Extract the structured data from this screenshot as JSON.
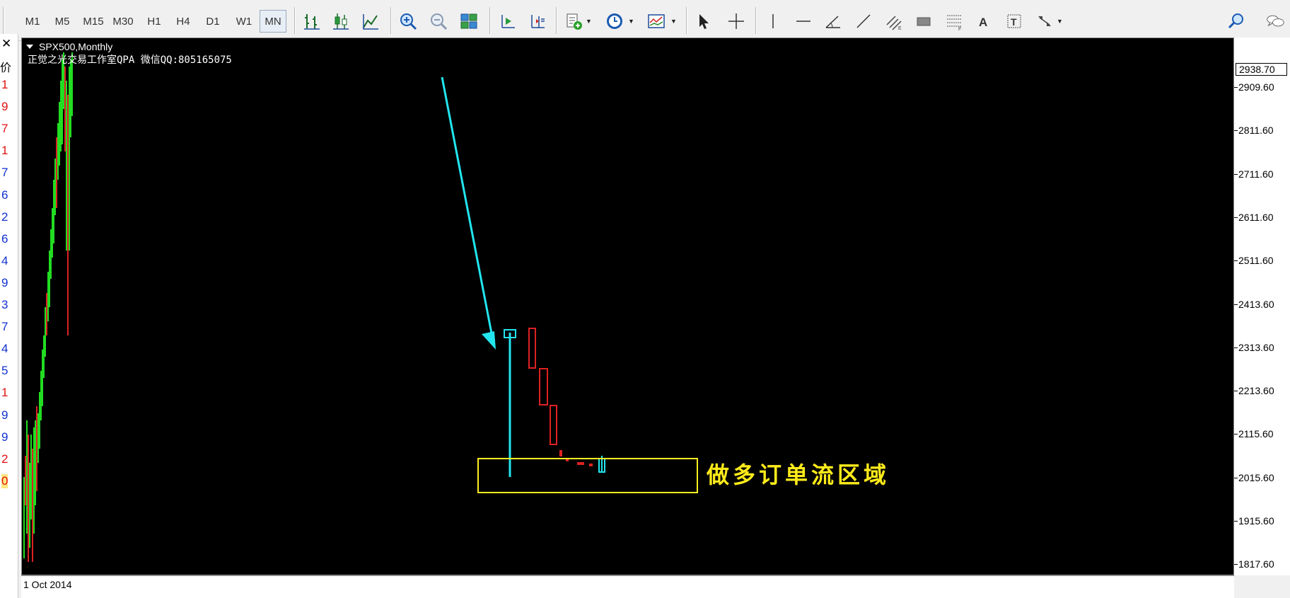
{
  "toolbar": {
    "timeframes": [
      "M1",
      "M5",
      "M15",
      "M30",
      "H1",
      "H4",
      "D1",
      "W1",
      "MN"
    ],
    "active_timeframe": "MN"
  },
  "left_panel": {
    "close": "✕",
    "header": "价",
    "digits": [
      {
        "text": "1",
        "color": "#e01010"
      },
      {
        "text": "9",
        "color": "#e01010"
      },
      {
        "text": "7",
        "color": "#e01010"
      },
      {
        "text": "1",
        "color": "#e01010"
      },
      {
        "text": "7",
        "color": "#1030d0"
      },
      {
        "text": "6",
        "color": "#1030d0"
      },
      {
        "text": "2",
        "color": "#1030d0"
      },
      {
        "text": "6",
        "color": "#1030d0"
      },
      {
        "text": "4",
        "color": "#1030d0"
      },
      {
        "text": "9",
        "color": "#1030d0"
      },
      {
        "text": "3",
        "color": "#1030d0"
      },
      {
        "text": "7",
        "color": "#1030d0"
      },
      {
        "text": "4",
        "color": "#1030d0"
      },
      {
        "text": "5",
        "color": "#1030d0"
      },
      {
        "text": "1",
        "color": "#e01010"
      },
      {
        "text": "9",
        "color": "#1030d0"
      },
      {
        "text": "9",
        "color": "#1030d0"
      },
      {
        "text": "2",
        "color": "#e01010"
      },
      {
        "text": "0",
        "color": "#e01010"
      }
    ]
  },
  "chart": {
    "symbol": "SPX500,Monthly",
    "studio_text": "正觉之光交易工作室QPA 微信QQ:805165075",
    "zone_text": "做多订单流区域",
    "current_price": "2938.70",
    "price_ticks": [
      "2909.60",
      "2811.60",
      "2711.60",
      "2611.60",
      "2511.60",
      "2413.60",
      "2313.60",
      "2213.60",
      "2115.60",
      "2015.60",
      "1915.60",
      "1817.60"
    ],
    "time_label": "1 Oct 2014",
    "colors": {
      "background": "#000000",
      "bull": "#22dd22",
      "bear": "#dd2222",
      "annotation": "#22e5ee",
      "zone": "#ffee22"
    }
  }
}
